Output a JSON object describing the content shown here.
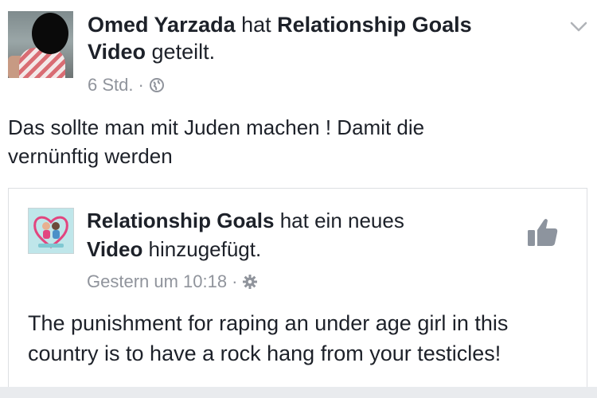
{
  "post": {
    "author": "Omed Yarzada",
    "action_1": " hat ",
    "shared_page": "Relationship Goals",
    "shared_type": "Video",
    "action_2": " geteilt.",
    "time": "6 Std.",
    "separator": "·",
    "privacy_icon": "globe-icon",
    "menu_icon": "chevron-down-icon",
    "text_line_1": "Das sollte man mit Juden machen ! Damit die",
    "text_line_2": "vernünftig werden"
  },
  "shared_card": {
    "page_name": "Relationship Goals",
    "action_1": " hat ein neues",
    "content_type": "Video",
    "action_2": " hinzugefügt.",
    "time": "Gestern um 10:18",
    "separator": "·",
    "privacy_icon": "gear-icon",
    "like_icon": "thumbs-up-icon",
    "text_line_1": "The punishment for raping an under age girl in this",
    "text_line_2": "country is to have a rock hang from your testicles!"
  }
}
